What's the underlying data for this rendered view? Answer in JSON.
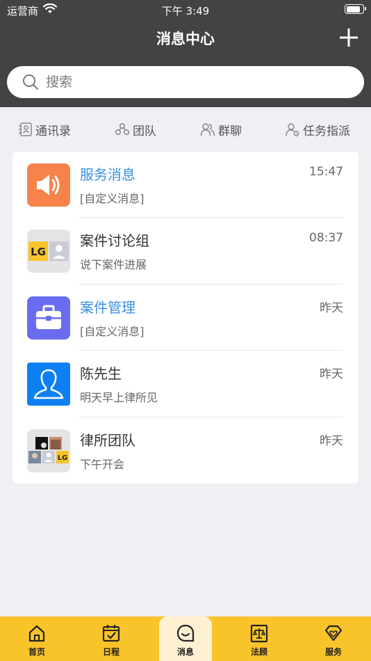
{
  "status_bar": {
    "carrier": "运营商",
    "time": "下午 3:49",
    "battery_level": 0.9
  },
  "nav": {
    "title": "消息中心",
    "add_icon": "plus-icon"
  },
  "search": {
    "placeholder": "搜索",
    "icon": "search-icon"
  },
  "quick_actions": [
    {
      "label": "通讯录",
      "icon": "contacts-icon"
    },
    {
      "label": "团队",
      "icon": "team-icon"
    },
    {
      "label": "群聊",
      "icon": "group-chat-icon"
    },
    {
      "label": "任务指派",
      "icon": "task-assign-icon"
    }
  ],
  "messages": [
    {
      "title": "服务消息",
      "subtitle": "[自定义消息]",
      "time": "15:47",
      "avatar": "speaker-icon",
      "avatar_color": "#f5834a",
      "highlight": true
    },
    {
      "title": "案件讨论组",
      "subtitle": "说下案件进展",
      "time": "08:37",
      "avatar": "group-avatar",
      "avatar_color": "#e4e4e4",
      "highlight": false
    },
    {
      "title": "案件管理",
      "subtitle": "[自定义消息]",
      "time": "昨天",
      "avatar": "briefcase-icon",
      "avatar_color": "#6a6cf0",
      "highlight": true
    },
    {
      "title": "陈先生",
      "subtitle": "明天早上律所见",
      "time": "昨天",
      "avatar": "person-icon",
      "avatar_color": "#0d7ff2",
      "highlight": false
    },
    {
      "title": "律所团队",
      "subtitle": "下午开会",
      "time": "昨天",
      "avatar": "group-avatar",
      "avatar_color": "#e4e4e4",
      "highlight": false
    }
  ],
  "tabbar": {
    "active": "消息",
    "tabs": [
      {
        "label": "首页",
        "icon": "home-icon"
      },
      {
        "label": "日程",
        "icon": "calendar-icon"
      },
      {
        "label": "消息",
        "icon": "message-icon"
      },
      {
        "label": "法顾",
        "icon": "legal-book-icon"
      },
      {
        "label": "服务",
        "icon": "service-heart-icon"
      }
    ]
  },
  "colors": {
    "header_bg": "#454245",
    "accent_blue": "#3a8ee6",
    "tabbar_bg": "#f9c42a",
    "page_bg": "#efeff4"
  }
}
